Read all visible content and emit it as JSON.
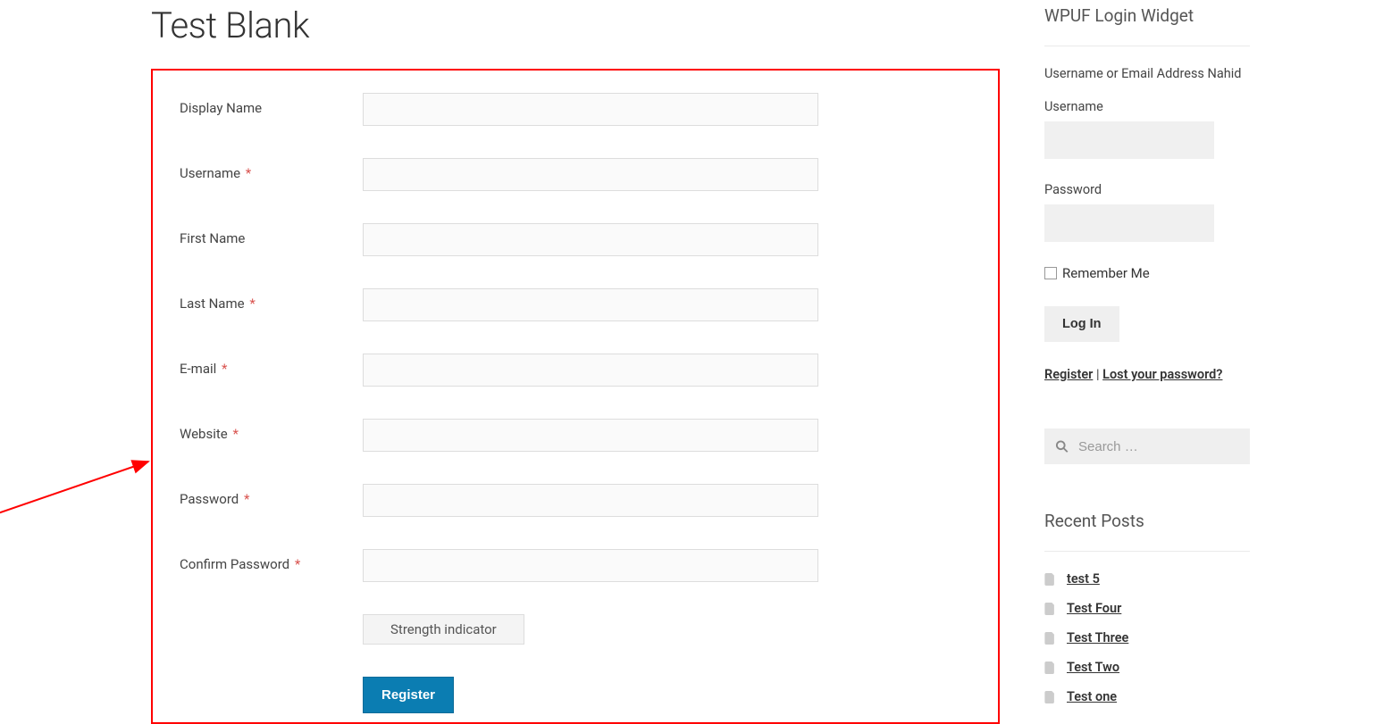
{
  "pageTitle": "Test Blank",
  "form": {
    "fields": {
      "displayName": {
        "label": "Display Name",
        "required": false
      },
      "username": {
        "label": "Username",
        "required": true
      },
      "firstName": {
        "label": "First Name",
        "required": false
      },
      "lastName": {
        "label": "Last Name",
        "required": true
      },
      "email": {
        "label": "E-mail",
        "required": true
      },
      "website": {
        "label": "Website",
        "required": true
      },
      "password": {
        "label": "Password",
        "required": true
      },
      "confirmPassword": {
        "label": "Confirm Password",
        "required": true
      }
    },
    "strengthLabel": "Strength indicator",
    "submitLabel": "Register"
  },
  "loginWidget": {
    "title": "WPUF Login Widget",
    "intro": "Username or Email Address Nahid",
    "usernameLabel": "Username",
    "passwordLabel": "Password",
    "rememberLabel": "Remember Me",
    "loginButton": "Log In",
    "registerLink": "Register",
    "separator": " | ",
    "lostPasswordLink": "Lost your password?"
  },
  "search": {
    "placeholder": "Search …"
  },
  "recentPosts": {
    "title": "Recent Posts",
    "items": [
      "test 5",
      "Test Four",
      "Test Three",
      "Test Two",
      "Test one"
    ]
  }
}
